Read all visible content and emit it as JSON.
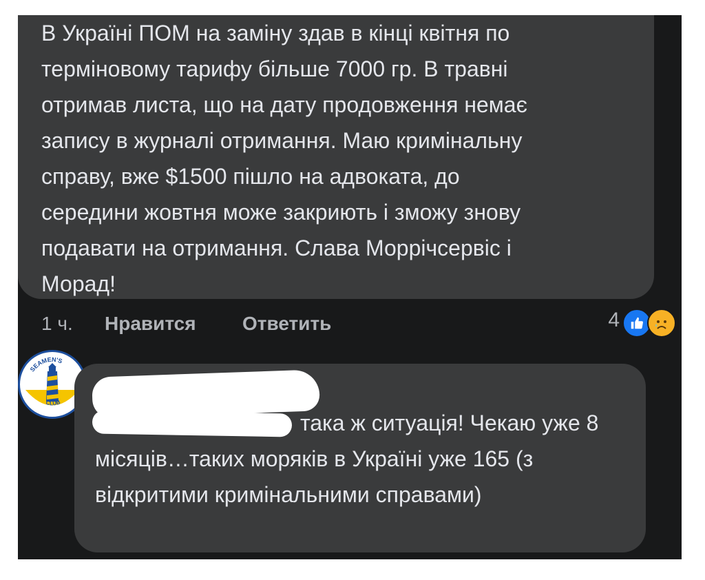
{
  "comment1": {
    "text": "В Україні ПОМ на заміну здав в кінці квітня по терміновому тарифу  більше 7000 гр. В травні отримав листа, що на дату продовження немає запису в журналі отримання. Маю кримінальну справу, вже $1500 пішло на адвоката, до середини жовтня може закриють і зможу знову подавати на отримання. Слава Моррічсервіс і Морад!",
    "time": "1 ч.",
    "like_label": "Нравится",
    "reply_label": "Ответить",
    "reaction_count": "4",
    "reactions": [
      "like-icon",
      "sad-face-icon"
    ]
  },
  "comment2": {
    "avatar_logo": "SEAMEN'S CLUB",
    "text": "така ж ситуація! Чекаю уже 8 місяців…таких моряків в Україні уже 165 (з відкритими кримінальними справами)"
  },
  "colors": {
    "background": "#18191a",
    "bubble": "#3a3b3c",
    "text": "#e4e6eb",
    "muted": "#b0b3b8",
    "like_blue": "#1877f2",
    "sad_yellow": "#f7b125"
  }
}
